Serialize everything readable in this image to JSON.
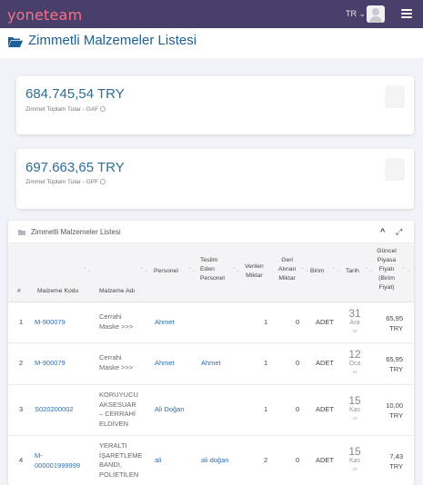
{
  "topbar": {
    "logo": "yoneteam",
    "language": "TR",
    "language_caret": "⌄"
  },
  "page": {
    "title": "Zimmetli Malzemeler Listesi"
  },
  "summary_cards": [
    {
      "amount": "684.745,54 TRY",
      "label": "Zimmet Toplam Tutar - GAF"
    },
    {
      "amount": "697.663,65 TRY",
      "label": "Zimmet Toplam Tutar - GPF"
    }
  ],
  "list": {
    "title": "Zimmetli Malzemeler Listesi",
    "collapse_glyph": "^",
    "expand_glyph": "⤢",
    "sort_glyph": "⌃⌄",
    "columns": {
      "num": "#",
      "code": "Malzeme Kodu",
      "name": "Malzeme Adı",
      "person": "Personel",
      "handover": [
        "Teslim",
        "Eden",
        "Personel"
      ],
      "given": [
        "Verilen",
        "Miktar"
      ],
      "returned": [
        "Geri",
        "Alınan",
        "Miktar"
      ],
      "unit": "Birim",
      "date": "Tarih",
      "price": [
        "Güncel",
        "Piyasa",
        "Fiyatı",
        "(Birim",
        "Fiyat)"
      ]
    },
    "rows": [
      {
        "num": "1",
        "code": [
          "M-900079"
        ],
        "name": [
          "Cerrahi",
          "Maske >>>"
        ],
        "person": "Ahmet",
        "handover": "",
        "given": "1",
        "returned": "0",
        "unit": "ADET",
        "day": "31",
        "month": "Ara",
        "year": "23",
        "price": [
          "65,95",
          "TRY"
        ]
      },
      {
        "num": "2",
        "code": [
          "M-900079"
        ],
        "name": [
          "Cerrahi",
          "Maske >>>"
        ],
        "person": "Ahmet",
        "handover": "Ahmet",
        "given": "1",
        "returned": "0",
        "unit": "ADET",
        "day": "12",
        "month": "Oca",
        "year": "24",
        "price": [
          "65,95",
          "TRY"
        ]
      },
      {
        "num": "3",
        "code": [
          "S020200002"
        ],
        "name": [
          "KORUYUCU",
          "AKSESUAR",
          "– CERRAHİ",
          "ELDİVEN"
        ],
        "person": "Ali Doğan",
        "handover": "",
        "given": "1",
        "returned": "0",
        "unit": "ADET",
        "day": "15",
        "month": "Kas",
        "year": "23",
        "price": [
          "10,00",
          "TRY"
        ]
      },
      {
        "num": "4",
        "code": [
          "M-",
          "000001999999"
        ],
        "name": [
          "YERALTI",
          "İŞARETLEME",
          "BANDI,",
          "POLİETİLEN"
        ],
        "person": "ali",
        "handover": "ali doğan",
        "given": "2",
        "returned": "0",
        "unit": "ADET",
        "day": "15",
        "month": "Kas",
        "year": "23",
        "price": [
          "7,43",
          "TRY"
        ]
      }
    ]
  },
  "colors": {
    "topbar": "#4a3f6b",
    "logo": "#f2728a",
    "title": "#1d5f96",
    "link": "#2e6eac",
    "amount": "#2e6e92",
    "background": "#f2f3f8"
  },
  "icons": [
    "folder-open-icon",
    "user-avatar-icon",
    "hamburger-menu-icon",
    "info-icon",
    "chevron-up-icon",
    "expand-icon",
    "sort-icon"
  ]
}
